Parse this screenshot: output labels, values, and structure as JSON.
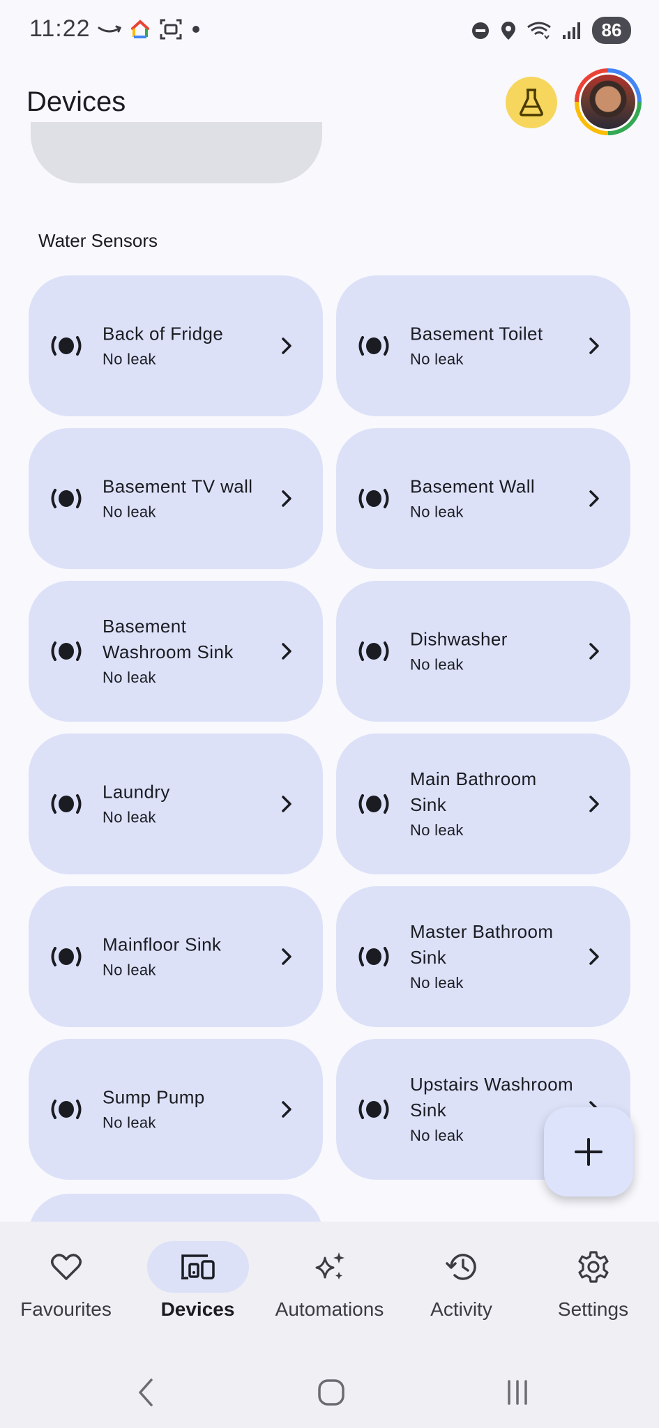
{
  "status_bar": {
    "time": "11:22",
    "battery": "86",
    "icons_left": [
      "amazon-icon",
      "google-home-icon",
      "screenshot-icon",
      "dot-icon"
    ],
    "icons_right": [
      "do-not-disturb-icon",
      "location-icon",
      "wifi-icon",
      "signal-icon",
      "battery-icon"
    ]
  },
  "header": {
    "title": "Devices",
    "labs_icon": "flask-icon",
    "avatar": "account-avatar"
  },
  "section": {
    "title": "Water Sensors"
  },
  "devices": [
    {
      "name": "Back of Fridge",
      "status": "No leak"
    },
    {
      "name": "Basement Toilet",
      "status": "No leak"
    },
    {
      "name": "Basement TV wall",
      "status": "No leak"
    },
    {
      "name": "Basement Wall",
      "status": "No leak"
    },
    {
      "name": "Basement Washroom Sink",
      "status": "No leak"
    },
    {
      "name": "Dishwasher",
      "status": "No leak"
    },
    {
      "name": "Laundry",
      "status": "No leak"
    },
    {
      "name": "Main Bathroom Sink",
      "status": "No leak"
    },
    {
      "name": "Mainfloor Sink",
      "status": "No leak"
    },
    {
      "name": "Master Bathroom Sink",
      "status": "No leak"
    },
    {
      "name": "Sump Pump",
      "status": "No leak"
    },
    {
      "name": "Upstairs Washroom Sink",
      "status": "No leak"
    }
  ],
  "fab": {
    "icon": "plus-icon"
  },
  "bottom_nav": [
    {
      "label": "Favourites",
      "icon": "heart-icon",
      "active": false
    },
    {
      "label": "Devices",
      "icon": "devices-icon",
      "active": true
    },
    {
      "label": "Automations",
      "icon": "sparkle-icon",
      "active": false
    },
    {
      "label": "Activity",
      "icon": "history-icon",
      "active": false
    },
    {
      "label": "Settings",
      "icon": "gear-icon",
      "active": false
    }
  ],
  "system_nav": [
    "back-icon",
    "home-icon",
    "recents-icon"
  ],
  "colors": {
    "background": "#f8f8fd",
    "card": "#dce1f8",
    "labs": "#f6d65c",
    "nav_bg": "#efeff4"
  }
}
